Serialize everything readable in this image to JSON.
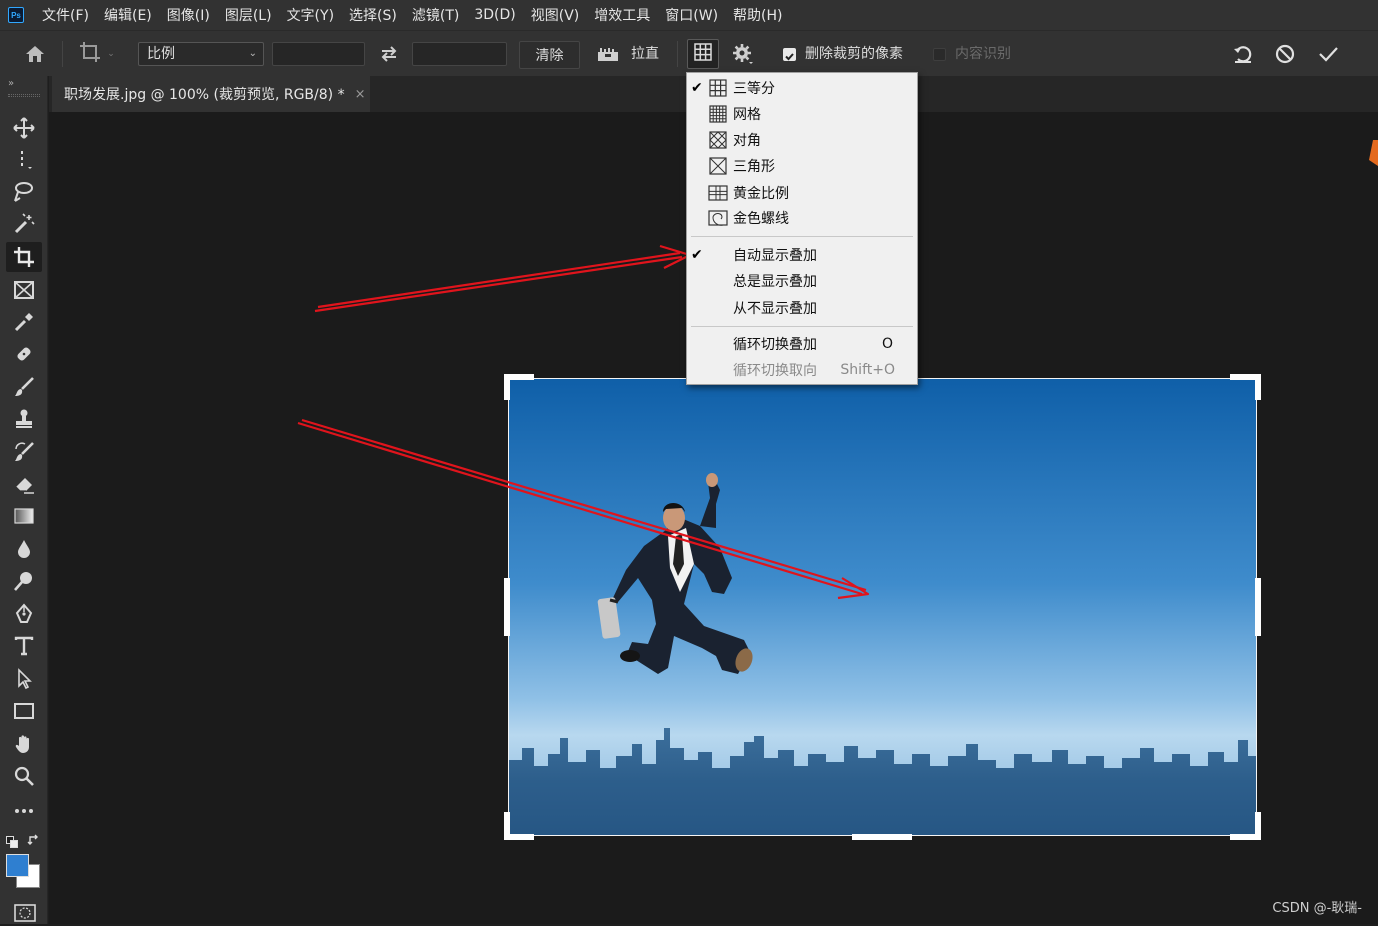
{
  "app": {
    "logo_text": "Ps"
  },
  "menubar": {
    "items": [
      "文件(F)",
      "编辑(E)",
      "图像(I)",
      "图层(L)",
      "文字(Y)",
      "选择(S)",
      "滤镜(T)",
      "3D(D)",
      "视图(V)",
      "增效工具",
      "窗口(W)",
      "帮助(H)"
    ]
  },
  "options": {
    "ratio_select": "比例",
    "width_value": "",
    "height_value": "",
    "clear_label": "清除",
    "straighten_label": "拉直",
    "delete_cropped_label": "删除裁剪的像素",
    "delete_cropped_checked": true,
    "content_aware_label": "内容识别",
    "content_aware_checked": false
  },
  "document": {
    "tab_title": "职场发展.jpg @ 100% (裁剪预览, RGB/8) *",
    "close_glyph": "×"
  },
  "overlay_menu": {
    "overlays": [
      {
        "label": "三等分",
        "checked": true,
        "icon": "thirds-icon"
      },
      {
        "label": "网格",
        "checked": false,
        "icon": "grid-icon"
      },
      {
        "label": "对角",
        "checked": false,
        "icon": "diagonal-icon"
      },
      {
        "label": "三角形",
        "checked": false,
        "icon": "triangle-icon"
      },
      {
        "label": "黄金比例",
        "checked": false,
        "icon": "golden-ratio-icon"
      },
      {
        "label": "金色螺线",
        "checked": false,
        "icon": "golden-spiral-icon"
      }
    ],
    "display_modes": [
      {
        "label": "自动显示叠加",
        "checked": true
      },
      {
        "label": "总是显示叠加",
        "checked": false
      },
      {
        "label": "从不显示叠加",
        "checked": false
      }
    ],
    "cycle_overlay": {
      "label": "循环切换叠加",
      "shortcut": "O",
      "enabled": true
    },
    "cycle_orientation": {
      "label": "循环切换取向",
      "shortcut": "Shift+O",
      "enabled": false
    }
  },
  "colors": {
    "foreground": "#2f7fd0",
    "background": "#ffffff",
    "annotation_arrow": "#e0141c"
  },
  "watermark": "CSDN @-耿瑞-"
}
